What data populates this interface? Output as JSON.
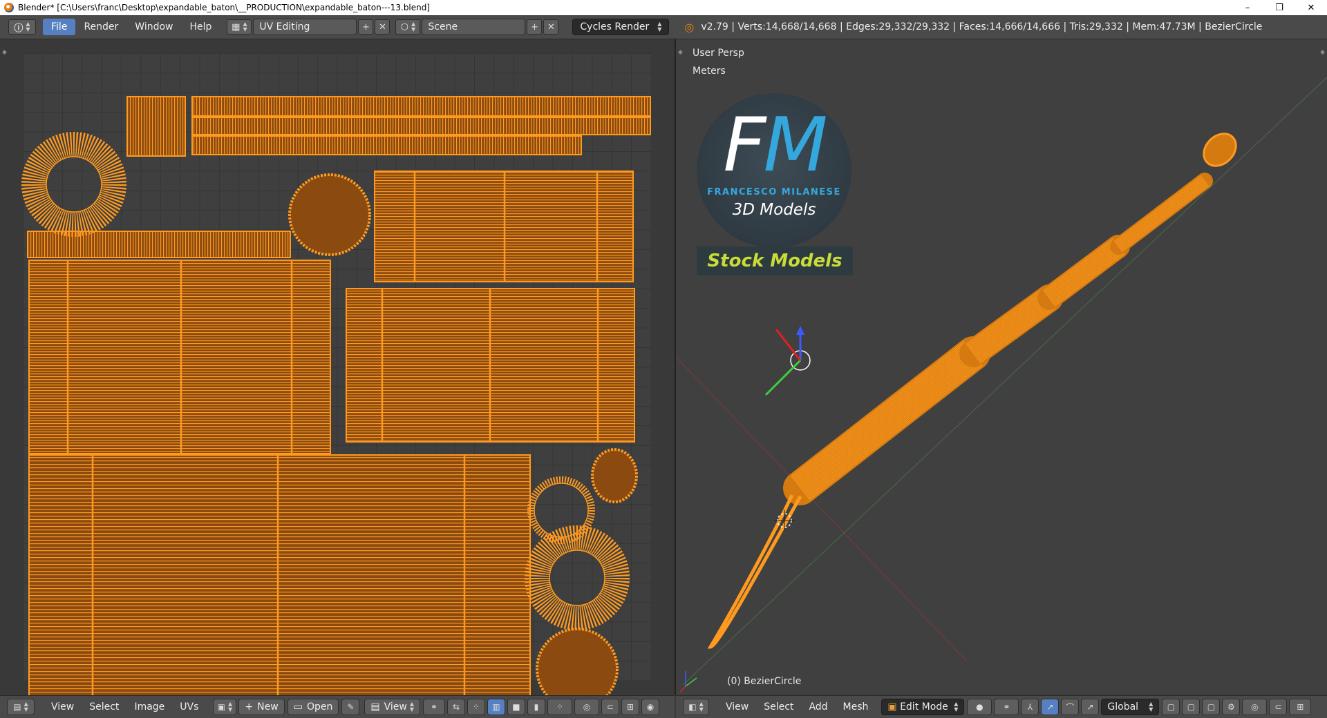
{
  "window": {
    "title": "Blender* [C:\\Users\\franc\\Desktop\\expandable_baton\\__PRODUCTION\\expandable_baton---13.blend]",
    "minimize": "–",
    "restore": "❐",
    "close": "✕"
  },
  "info_header": {
    "menus": [
      "File",
      "Render",
      "Window",
      "Help"
    ],
    "active_menu": "File",
    "screen_layout": "UV Editing",
    "scene": "Scene",
    "render_engine": "Cycles Render",
    "stats": "v2.79 | Verts:14,668/14,668 | Edges:29,332/29,332 | Faces:14,666/14,666 | Tris:29,332 | Mem:47.73M | BezierCircle"
  },
  "uv_footer": {
    "menus": [
      "View",
      "Select",
      "Image",
      "UVs"
    ],
    "new_label": "New",
    "open_label": "Open",
    "view_label": "View"
  },
  "viewport": {
    "view_name": "User Persp",
    "units": "Meters",
    "object_label": "(0) BezierCircle",
    "logo": {
      "letter_f": "F",
      "letter_m": "M",
      "brand_name": "FRANCESCO MILANESE",
      "brand_sub": "3D Models",
      "stock_label": "Stock Models"
    }
  },
  "vp_footer": {
    "menus": [
      "View",
      "Select",
      "Add",
      "Mesh"
    ],
    "mode": "Edit Mode",
    "orientation": "Global"
  },
  "colors": {
    "uv_wire": "#ff9a1f",
    "uv_fill": "#8a4a10",
    "accent_blue": "#5680c2",
    "logo_blue": "#34a8dc",
    "logo_yellow": "#c9dc37"
  }
}
